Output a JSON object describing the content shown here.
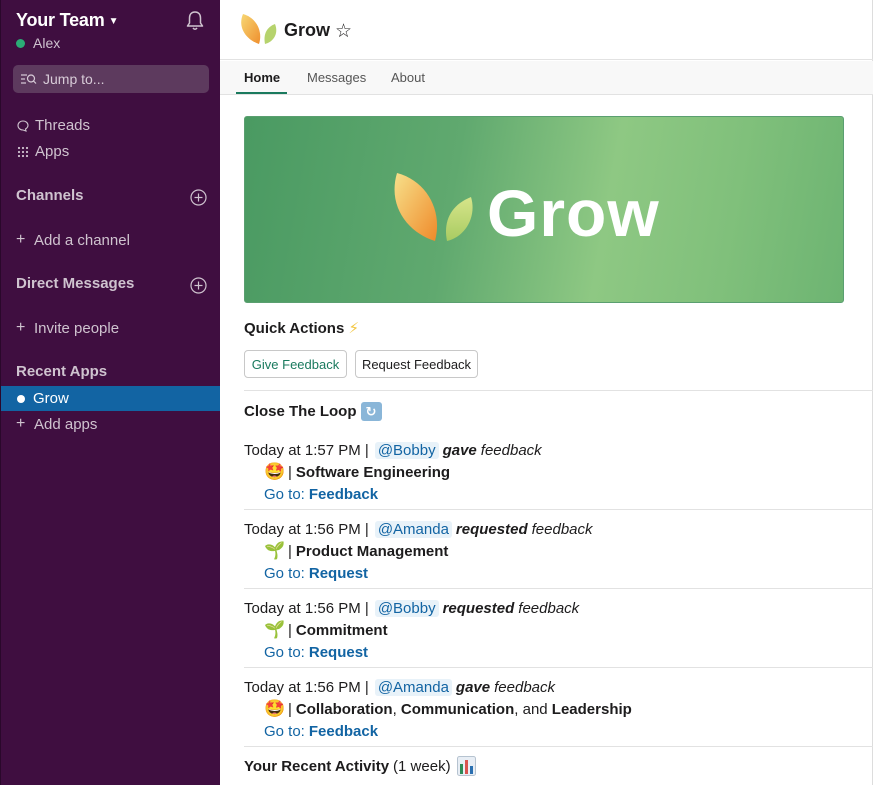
{
  "sidebar": {
    "team_name": "Your Team",
    "user_name": "Alex",
    "jump_placeholder": "Jump to...",
    "nav": [
      {
        "label": "Threads",
        "icon": "threads-icon"
      },
      {
        "label": "Apps",
        "icon": "apps-grid-icon"
      }
    ],
    "channels_title": "Channels",
    "add_channel": "Add a channel",
    "dm_title": "Direct Messages",
    "invite_people": "Invite people",
    "recent_apps_title": "Recent Apps",
    "active_app": "Grow",
    "add_apps": "Add apps",
    "colors": {
      "background": "#3f0e40",
      "active": "#1264a3",
      "presence": "#2bac76"
    }
  },
  "header": {
    "title": "Grow",
    "tabs": [
      "Home",
      "Messages",
      "About"
    ],
    "active_tab": "Home"
  },
  "banner": {
    "text": "Grow"
  },
  "quick_actions": {
    "title": "Quick Actions",
    "emoji": "⚡",
    "give_label": "Give Feedback",
    "request_label": "Request Feedback"
  },
  "close_the_loop": {
    "title": "Close The Loop",
    "entries": [
      {
        "time": "Today at 1:57 PM |",
        "user": "@Bobby",
        "verb": "gave",
        "suffix": "feedback",
        "emoji": "🤩",
        "separator": "|",
        "category": "Software Engineering",
        "goto": "Go to:",
        "link": "Feedback"
      },
      {
        "time": "Today at 1:56 PM |",
        "user": "@Amanda",
        "verb": "requested",
        "suffix": "feedback",
        "emoji": "🌱",
        "separator": "|",
        "category": "Product Management",
        "goto": "Go to:",
        "link": "Request"
      },
      {
        "time": "Today at 1:56 PM |",
        "user": "@Bobby",
        "verb": "requested",
        "suffix": "feedback",
        "emoji": "🌱",
        "separator": "|",
        "category": "Commitment",
        "goto": "Go to:",
        "link": "Request"
      },
      {
        "time": "Today at 1:56 PM |",
        "user": "@Amanda",
        "verb": "gave",
        "suffix": "feedback",
        "emoji": "🤩",
        "separator": "|",
        "category_parts": [
          "Collaboration",
          ", ",
          "Communication",
          ", and ",
          "Leadership"
        ],
        "goto": "Go to:",
        "link": "Feedback"
      }
    ]
  },
  "recent_activity": {
    "title": "Your Recent Activity",
    "period": "(1 week)"
  }
}
